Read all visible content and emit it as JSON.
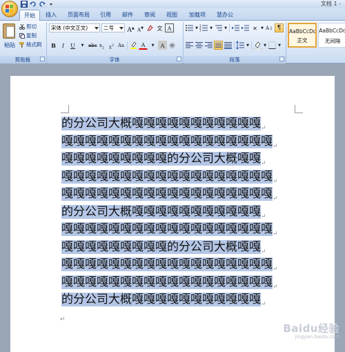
{
  "titlebar": {
    "document_title": "文档 1 - "
  },
  "tabs": [
    "开始",
    "插入",
    "页面布局",
    "引用",
    "邮件",
    "审阅",
    "视图",
    "加载项",
    "慧办公"
  ],
  "clipboard": {
    "paste_label": "粘贴",
    "cut_label": "剪切",
    "copy_label": "复制",
    "format_painter_label": "格式刷",
    "group_label": "剪贴板"
  },
  "font": {
    "font_name": "宋体 (中文正文)",
    "font_size": "二号",
    "group_label": "字体"
  },
  "paragraph": {
    "group_label": "段落"
  },
  "styles": {
    "items": [
      {
        "sample": "AaBbCcDd",
        "name": "正文"
      },
      {
        "sample": "AaBbCcDd",
        "name": "无间隔"
      }
    ]
  },
  "document": {
    "lines": [
      "的分公司大概嘎嘎嘎嘎嘎嘎嘎嘎嘎嘎嘎",
      "嘎嘎嘎嘎嘎嘎嘎嘎嘎嘎嘎嘎嘎嘎嘎嘎嘎嘎",
      "嘎嘎嘎嘎嘎嘎嘎嘎嘎的分公司大概嘎嘎",
      "嘎嘎嘎嘎嘎嘎嘎嘎嘎嘎嘎嘎嘎嘎嘎嘎嘎嘎",
      "嘎嘎嘎嘎嘎嘎嘎嘎嘎嘎嘎嘎嘎嘎嘎嘎嘎嘎",
      "的分公司大概嘎嘎嘎嘎嘎嘎嘎嘎嘎嘎嘎",
      "嘎嘎嘎嘎嘎嘎嘎嘎嘎嘎嘎嘎嘎嘎嘎嘎嘎嘎",
      "嘎嘎嘎嘎嘎嘎嘎嘎嘎的分公司大概嘎嘎",
      "嘎嘎嘎嘎嘎嘎嘎嘎嘎嘎嘎嘎嘎嘎嘎嘎嘎嘎",
      "嘎嘎嘎嘎嘎嘎嘎嘎嘎嘎嘎嘎嘎嘎嘎嘎嘎嘎",
      "的分公司大概嘎嘎嘎嘎嘎嘎嘎嘎嘎嘎嘎"
    ],
    "paragraph_mark": "↵"
  },
  "watermark": {
    "brand": "Baidu经验",
    "url": "jingyan.baidu.com"
  },
  "colors": {
    "ribbon_text": "#15428b",
    "selection": "#b4c6e6",
    "page_background": "#9aa5b6",
    "font_color_underline": "#e00000",
    "highlight_yellow": "#ffff00"
  }
}
